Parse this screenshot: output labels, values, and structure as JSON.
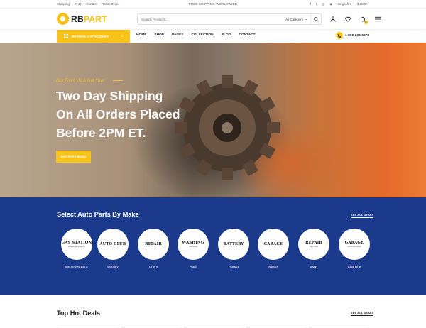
{
  "topbar": {
    "links": [
      "Shipping",
      "FAQ",
      "Contact",
      "Track Order"
    ],
    "promo": "FREE SHIPPING WORLDWIDE",
    "social": [
      "f",
      "t",
      "◎",
      "◉"
    ],
    "language": "English",
    "currency": "$ USD"
  },
  "header": {
    "logo_rb": "RB",
    "logo_part": "PART",
    "search_placeholder": "Search Products...",
    "category": "All Category",
    "cart_count": "0"
  },
  "nav": {
    "browse": "BROWSE CATEGORIES",
    "menu": [
      "HOME",
      "SHOP",
      "PAGES",
      "COLLECTION",
      "BLOG",
      "CONTACT"
    ],
    "phone": "1-800-234-5678"
  },
  "hero": {
    "kicker": "Buy From Us & Get Your",
    "title_lines": [
      "Two Day Shipping",
      "On All Orders Placed",
      "Before 2PM ET."
    ],
    "button": "DISCOVER MORE"
  },
  "makes": {
    "title": "Select Auto Parts By Make",
    "see_all": "SEE ALL DEALS",
    "brands": [
      {
        "name": "Mercedes Benz",
        "logo": "GAS STATION",
        "sub": "PREMIUM QUALITY"
      },
      {
        "name": "Bentley",
        "logo": "AUTO CLUB",
        "sub": ""
      },
      {
        "name": "Chery",
        "logo": "REPAIR",
        "sub": ""
      },
      {
        "name": "Audi",
        "logo": "WASHING",
        "sub": "SERVICE"
      },
      {
        "name": "Honda",
        "logo": "BATTERY",
        "sub": ""
      },
      {
        "name": "Maxus",
        "logo": "GARAGE",
        "sub": ""
      },
      {
        "name": "BMW",
        "logo": "REPAIR",
        "sub": "EST. 2020"
      },
      {
        "name": "Changhe",
        "logo": "GARAGE",
        "sub": "CUSTOM SHOP"
      }
    ]
  },
  "deals": {
    "title": "Top Hot Deals",
    "see_all": "SEE ALL DEALS"
  }
}
